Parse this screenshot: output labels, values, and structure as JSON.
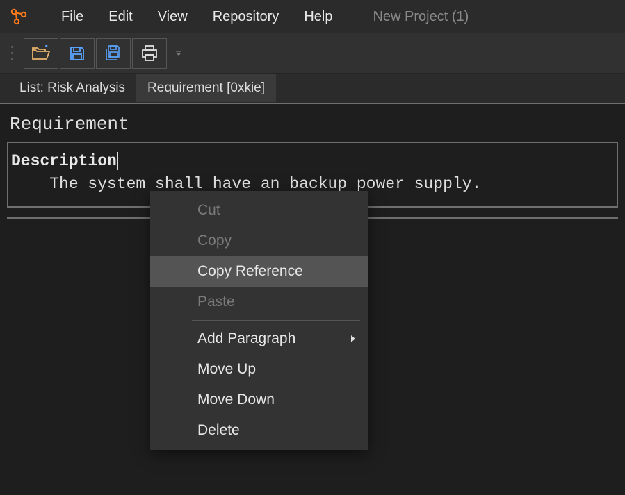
{
  "menubar": {
    "items": [
      "File",
      "Edit",
      "View",
      "Repository",
      "Help"
    ],
    "project": "New Project (1)"
  },
  "tabs": [
    {
      "label": "List: Risk Analysis",
      "active": false
    },
    {
      "label": "Requirement [0xkie]",
      "active": true
    }
  ],
  "content": {
    "heading": "Requirement",
    "description_label": "Description",
    "description_text": "    The system shall have an backup power supply."
  },
  "context_menu": {
    "items": [
      {
        "label": "Cut",
        "disabled": true
      },
      {
        "label": "Copy",
        "disabled": true
      },
      {
        "label": "Copy Reference",
        "hover": true
      },
      {
        "label": "Paste",
        "disabled": true
      },
      {
        "separator": true
      },
      {
        "label": "Add Paragraph",
        "submenu": true
      },
      {
        "label": "Move Up"
      },
      {
        "label": "Move Down"
      },
      {
        "label": "Delete"
      }
    ]
  },
  "colors": {
    "accent": "#ff7a1a",
    "icon_blue": "#5aa5ff",
    "icon_tan": "#e8b36c"
  }
}
